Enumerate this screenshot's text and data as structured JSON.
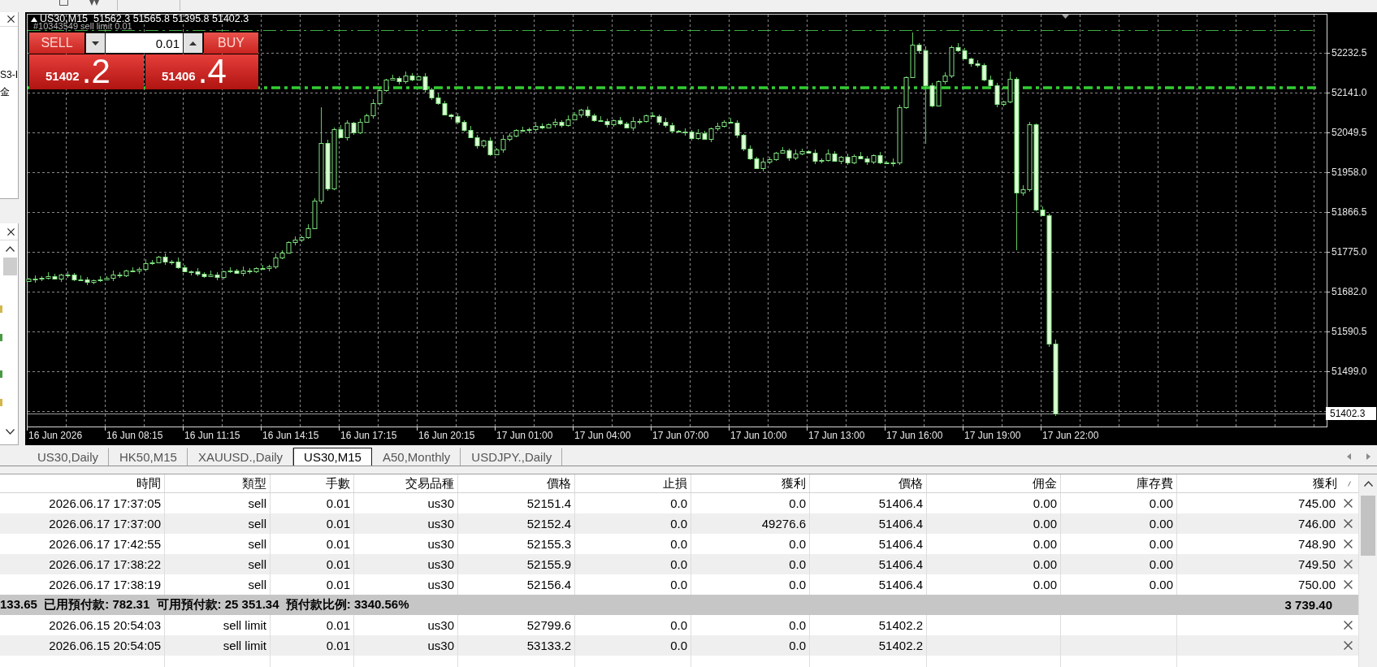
{
  "left_panel": {
    "texts": [
      "S3-I",
      "金"
    ]
  },
  "chart": {
    "header": "US30,M15  51562.3 51565.8 51395.8 51402.3",
    "order_label": "#10343549 sell limit 0.01",
    "trade_panel": {
      "sell_label": "SELL",
      "volume": "0.01",
      "buy_label": "BUY",
      "sell_price": {
        "big_figure": "51402",
        "pips": ".2"
      },
      "buy_price": {
        "big_figure": "51406",
        "pips": ".4"
      }
    },
    "price_axis": [
      "52232.5",
      "52141.0",
      "52049.5",
      "51958.0",
      "51866.5",
      "51775.0",
      "51682.0",
      "51590.5",
      "51499.0"
    ],
    "current_price": "51402.3",
    "time_axis": [
      "16 Jun 2026",
      "16 Jun 08:15",
      "16 Jun 11:15",
      "16 Jun 14:15",
      "16 Jun 17:15",
      "16 Jun 20:15",
      "17 Jun 01:00",
      "17 Jun 04:00",
      "17 Jun 07:00",
      "17 Jun 10:00",
      "17 Jun 13:00",
      "17 Jun 16:00",
      "17 Jun 19:00",
      "17 Jun 22:00"
    ]
  },
  "chart_tabs": [
    {
      "label": "US30,Daily",
      "selected": false
    },
    {
      "label": "HK50,M15",
      "selected": false
    },
    {
      "label": "XAUUSD.,Daily",
      "selected": false
    },
    {
      "label": "US30,M15",
      "selected": true
    },
    {
      "label": "A50,Monthly",
      "selected": false
    },
    {
      "label": "USDJPY.,Daily",
      "selected": false
    }
  ],
  "table": {
    "columns": [
      "時間",
      "類型",
      "手數",
      "交易品種",
      "價格",
      "止損",
      "獲利",
      "價格",
      "佣金",
      "庫存費",
      "獲利"
    ],
    "rows": [
      {
        "kind": "order",
        "cells": [
          "2026.06.17 17:37:05",
          "sell",
          "0.01",
          "us30",
          "52151.4",
          "0.0",
          "0.0",
          "51406.4",
          "0.00",
          "0.00",
          "745.00"
        ]
      },
      {
        "kind": "order",
        "cells": [
          "2026.06.17 17:37:00",
          "sell",
          "0.01",
          "us30",
          "52152.4",
          "0.0",
          "49276.6",
          "51406.4",
          "0.00",
          "0.00",
          "746.00"
        ]
      },
      {
        "kind": "order",
        "cells": [
          "2026.06.17 17:42:55",
          "sell",
          "0.01",
          "us30",
          "52155.3",
          "0.0",
          "0.0",
          "51406.4",
          "0.00",
          "0.00",
          "748.90"
        ]
      },
      {
        "kind": "order",
        "cells": [
          "2026.06.17 17:38:22",
          "sell",
          "0.01",
          "us30",
          "52155.9",
          "0.0",
          "0.0",
          "51406.4",
          "0.00",
          "0.00",
          "749.50"
        ]
      },
      {
        "kind": "order",
        "cells": [
          "2026.06.17 17:38:19",
          "sell",
          "0.01",
          "us30",
          "52156.4",
          "0.0",
          "0.0",
          "51406.4",
          "0.00",
          "0.00",
          "750.00"
        ]
      },
      {
        "kind": "summary",
        "text": "133.65  已用預付款: 782.31  可用預付款: 25 351.34  預付款比例: 3340.56%",
        "total": "3 739.40"
      },
      {
        "kind": "order",
        "cells": [
          "2026.06.15 20:54:03",
          "sell limit",
          "0.01",
          "us30",
          "52799.6",
          "0.0",
          "0.0",
          "51402.2"
        ]
      },
      {
        "kind": "order",
        "cells": [
          "2026.06.15 20:54:05",
          "sell limit",
          "0.01",
          "us30",
          "53133.2",
          "0.0",
          "0.0",
          "51402.2"
        ]
      },
      {
        "kind": "clipped"
      }
    ]
  }
}
